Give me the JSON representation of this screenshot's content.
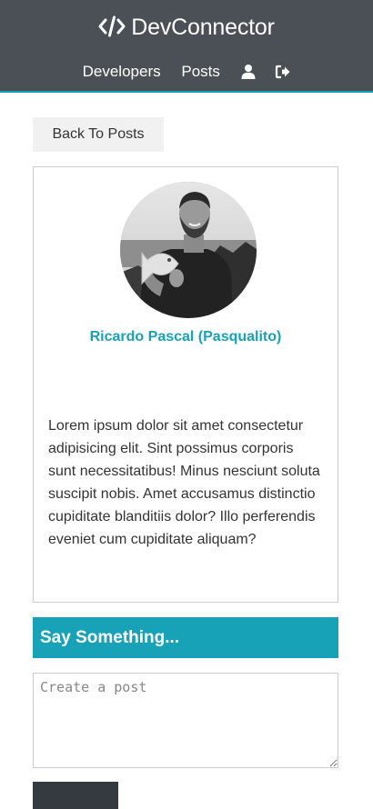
{
  "navbar": {
    "brand_label": "DevConnector",
    "brand_icon": "code-icon",
    "links": [
      {
        "label": "Developers"
      },
      {
        "label": "Posts"
      }
    ],
    "icons": [
      "user-icon",
      "sign-out-icon"
    ]
  },
  "back_button": {
    "label": "Back To Posts"
  },
  "post": {
    "author_name": "Ricardo Pascal (Pasqualito)",
    "text": "Lorem ipsum dolor sit amet consectetur adipisicing elit. Sint possimus corporis sunt necessitatibus! Minus nesciunt soluta suscipit nobis. Amet accusamus distinctio cupiditate blanditiis dolor? Illo perferendis eveniet cum cupiditate aliquam?"
  },
  "comment_form": {
    "header": "Say Something...",
    "placeholder": "Create a post",
    "value": ""
  },
  "colors": {
    "navbar_bg": "#4b5056",
    "accent": "#17a2b8",
    "light_bg": "#f1f1f1",
    "dark_btn": "#343a40"
  }
}
